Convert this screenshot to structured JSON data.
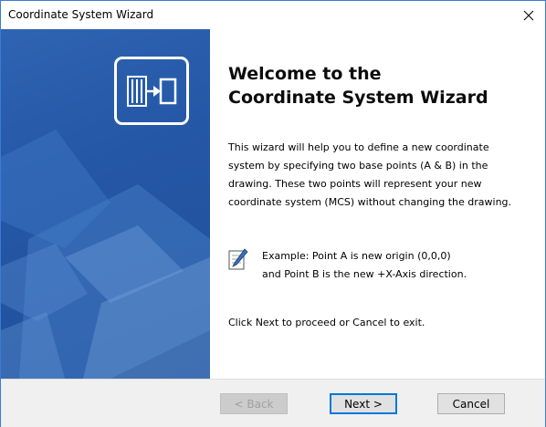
{
  "window": {
    "title": "Coordinate System Wizard",
    "close_glyph": "✕"
  },
  "panel": {
    "accent_color": "#2457a6",
    "logo_icon": "coordinate-system-wizard-icon"
  },
  "content": {
    "heading_line1": "Welcome to the",
    "heading_line2": "Coordinate System Wizard",
    "desc_line1": "This wizard will help you to define a new coordinate",
    "desc_line2": "system by specifying two base points (A & B) in the",
    "desc_line3": "drawing. These two points will represent your new",
    "desc_line4": "coordinate system (MCS) without changing the drawing.",
    "note_icon": "notepad-icon",
    "example_line1": "Example: Point A is new origin (0,0,0)",
    "example_line2": "and Point B is the new +X-Axis direction.",
    "footer": "Click Next to proceed or Cancel to exit."
  },
  "buttons": {
    "back": "< Back",
    "next": "Next >",
    "cancel": "Cancel"
  }
}
